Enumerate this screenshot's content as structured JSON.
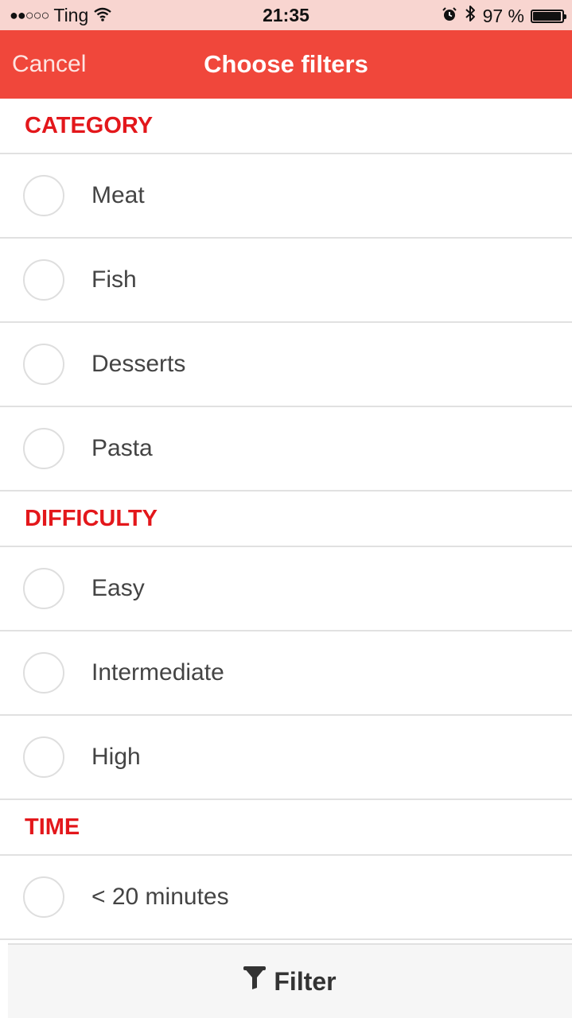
{
  "status_bar": {
    "signal": "●●○○○",
    "carrier": "Ting",
    "time": "21:35",
    "battery_text": "97 %",
    "battery_level": 0.97
  },
  "nav": {
    "cancel_label": "Cancel",
    "title": "Choose filters"
  },
  "sections": [
    {
      "header": "CATEGORY",
      "options": [
        "Meat",
        "Fish",
        "Desserts",
        "Pasta"
      ]
    },
    {
      "header": "DIFFICULTY",
      "options": [
        "Easy",
        "Intermediate",
        "High"
      ]
    },
    {
      "header": "TIME",
      "options": [
        "< 20 minutes"
      ]
    }
  ],
  "footer": {
    "filter_label": "Filter",
    "filter_icon": "funnel-icon"
  },
  "colors": {
    "accent": "#f0473b",
    "section_header": "#e3171b",
    "status_bar_bg": "#f8d5d0"
  }
}
